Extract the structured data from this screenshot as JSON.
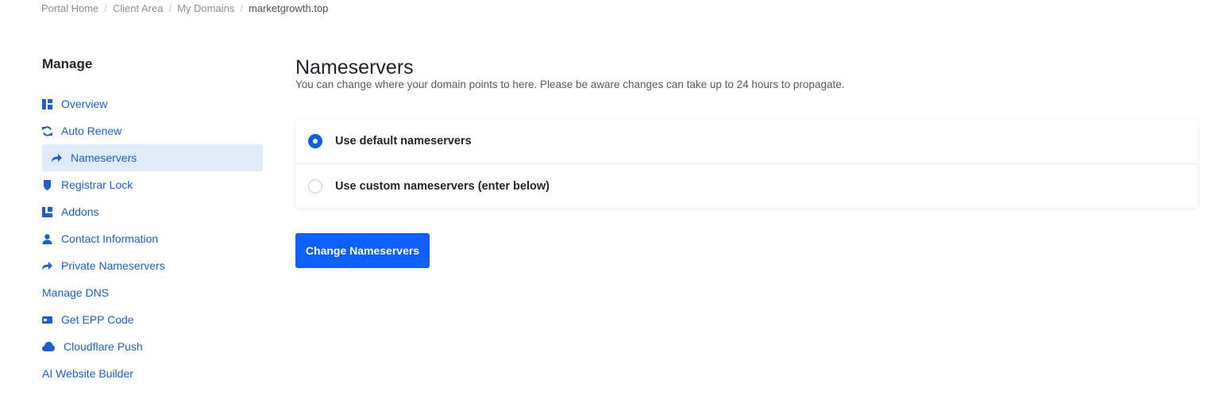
{
  "breadcrumb": {
    "items": [
      "Portal Home",
      "Client Area",
      "My Domains"
    ],
    "current": "marketgrowth.top",
    "separator": "/"
  },
  "sidebar": {
    "title": "Manage",
    "items": [
      {
        "label": "Overview",
        "icon": "dashboard-icon",
        "active": false
      },
      {
        "label": "Auto Renew",
        "icon": "sync-icon",
        "active": false
      },
      {
        "label": "Nameservers",
        "icon": "share-arrow-icon",
        "active": true
      },
      {
        "label": "Registrar Lock",
        "icon": "shield-icon",
        "active": false
      },
      {
        "label": "Addons",
        "icon": "cubes-icon",
        "active": false
      },
      {
        "label": "Contact Information",
        "icon": "user-icon",
        "active": false
      },
      {
        "label": "Private Nameservers",
        "icon": "share-arrow-icon",
        "active": false
      },
      {
        "label": "Manage DNS",
        "icon": "",
        "active": false
      },
      {
        "label": "Get EPP Code",
        "icon": "id-card-icon",
        "active": false
      },
      {
        "label": "Cloudflare Push",
        "icon": "cloud-icon",
        "active": false
      },
      {
        "label": "AI Website Builder",
        "icon": "",
        "active": false
      }
    ]
  },
  "main": {
    "title": "Nameservers",
    "description": "You can change where your domain points to here. Please be aware changes can take up to 24 hours to propagate.",
    "options": [
      {
        "label": "Use default nameservers",
        "checked": true
      },
      {
        "label": "Use custom nameservers (enter below)",
        "checked": false
      }
    ],
    "submit_label": "Change Nameservers"
  },
  "colors": {
    "accent": "#0d5ffe",
    "link": "#1a5fd6",
    "active_bg": "#e1ecfb"
  }
}
